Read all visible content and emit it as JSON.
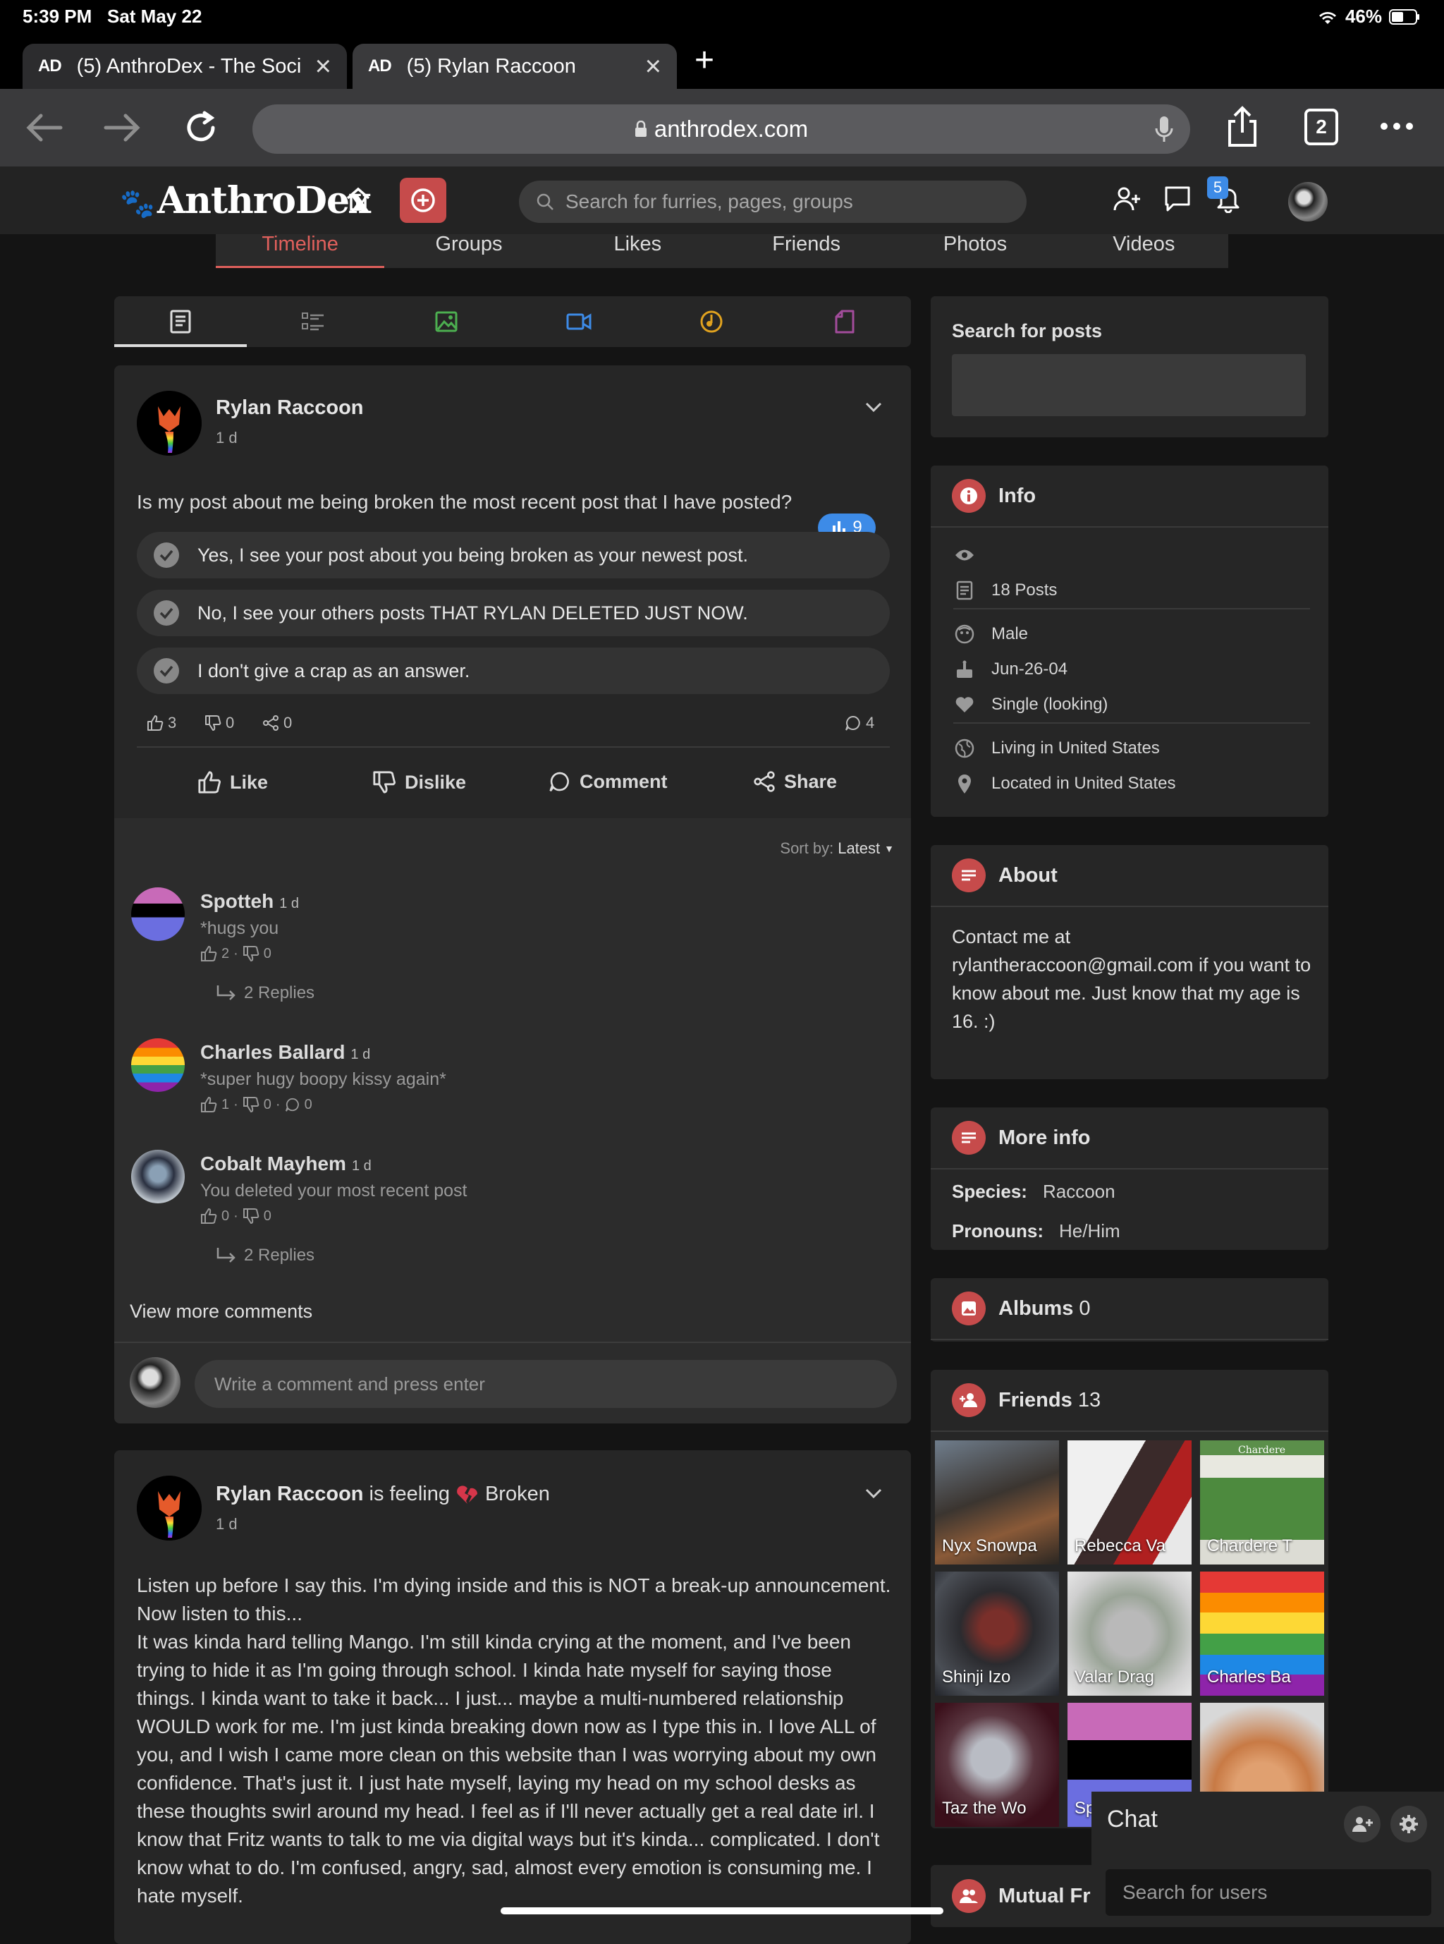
{
  "status": {
    "time": "5:39 PM",
    "date": "Sat May 22",
    "battery": "46%"
  },
  "browser": {
    "tabs": [
      {
        "favicon": "AD",
        "title": "(5) AnthroDex - The Soci"
      },
      {
        "favicon": "AD",
        "title": "(5) Rylan Raccoon"
      }
    ],
    "url": "anthrodex.com",
    "tab_count": "2"
  },
  "site": {
    "logo": "AnthroDex",
    "search_placeholder": "Search for furries, pages, groups",
    "notification_count": "5"
  },
  "profile_tabs": [
    "Timeline",
    "Groups",
    "Likes",
    "Friends",
    "Photos",
    "Videos"
  ],
  "post1": {
    "author": "Rylan Raccoon",
    "time": "1 d",
    "question": "Is my post about me being broken the most recent post that I have posted?",
    "votes": "9",
    "options": [
      "Yes, I see your post about you being broken as your newest post.",
      "No, I see your others posts THAT RYLAN DELETED JUST NOW.",
      "I don't give a crap as an answer."
    ],
    "likes": "3",
    "dislikes": "0",
    "shares": "0",
    "comments": "4",
    "actions": {
      "like": "Like",
      "dislike": "Dislike",
      "comment": "Comment",
      "share": "Share"
    },
    "sort_label": "Sort by:",
    "sort_value": "Latest",
    "comment_list": [
      {
        "name": "Spotteh",
        "time": "1 d",
        "text": "*hugs you",
        "likes": "2",
        "dislikes": "0",
        "replies": "2 Replies"
      },
      {
        "name": "Charles Ballard",
        "time": "1 d",
        "text": "*super hugy boopy kissy again*",
        "likes": "1",
        "dislikes": "0",
        "comments": "0"
      },
      {
        "name": "Cobalt Mayhem",
        "time": "1 d",
        "text": "You deleted your most recent post",
        "likes": "0",
        "dislikes": "0",
        "replies": "2 Replies"
      }
    ],
    "view_more": "View more comments",
    "comment_placeholder": "Write a comment and press enter"
  },
  "post2": {
    "author": "Rylan Raccoon",
    "feeling_prefix": "is feeling",
    "feeling": "Broken",
    "time": "1 d",
    "paragraphs": [
      "Listen up before I say this. I'm dying inside and this is NOT a break-up announcement.",
      "Now listen to this...",
      "It was kinda hard telling Mango. I'm still kinda crying at the moment, and I've been trying to hide it as I'm going through school. I kinda hate myself for saying those things. I kinda want to take it back... I just... maybe a multi-numbered relationship WOULD work for me. I'm just kinda breaking down now as I type this in. I love ALL of you, and I wish I came more clean on this website than I was worrying about my own confidence. That's just it. I just hate myself, laying my head on my school desks as these thoughts swirl around my head. I feel as if I'll never actually get a real date irl. I know that Fritz wants to talk to me via digital ways but it's kinda... complicated. I don't know what to do. I'm confused, angry, sad, almost every emotion is consuming me. I hate myself."
    ]
  },
  "sidebar": {
    "search_title": "Search for posts",
    "info": {
      "title": "Info",
      "posts": "18 Posts",
      "gender": "Male",
      "birthday": "Jun-26-04",
      "relationship": "Single (looking)",
      "living": "Living in United States",
      "located": "Located in United States"
    },
    "about": {
      "title": "About",
      "text": "Contact me at rylantheraccoon@gmail.com if you want to know about me. Just know that my age is 16. :)"
    },
    "more_info": {
      "title": "More info",
      "species_label": "Species:",
      "species": "Raccoon",
      "pronouns_label": "Pronouns:",
      "pronouns": "He/Him"
    },
    "albums": {
      "title": "Albums",
      "count": "0"
    },
    "friends": {
      "title": "Friends",
      "count": "13",
      "list": [
        "Nyx Snowpa",
        "Rebecca Va",
        "Chardere T",
        "Shinji Izo",
        "Valar Drag",
        "Charles Ba",
        "Taz the Wo",
        "Sp",
        ""
      ],
      "sign_text": "Chardere"
    },
    "mutual": {
      "title": "Mutual Fri"
    }
  },
  "chat": {
    "title": "Chat",
    "search_placeholder": "Search for users"
  }
}
